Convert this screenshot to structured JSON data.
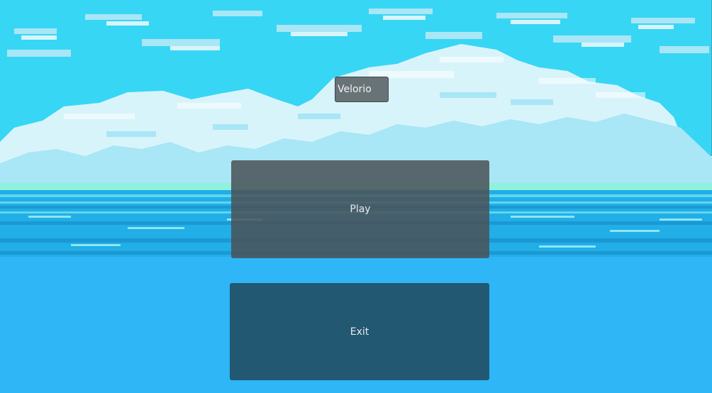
{
  "game": {
    "title": "Velorio",
    "menu": {
      "play_label": "Play",
      "exit_label": "Exit"
    }
  },
  "colors": {
    "sky": "#37d6f5",
    "cloud": "#d8f4fb",
    "cloud_shade": "#a9e6f6",
    "horizon": "#8ff2dc",
    "sea": "#22aee6",
    "deep_sea": "#2fb6f7",
    "play_button": "#4b5256",
    "exit_button": "#225872",
    "label_text": "#eaeaea"
  }
}
